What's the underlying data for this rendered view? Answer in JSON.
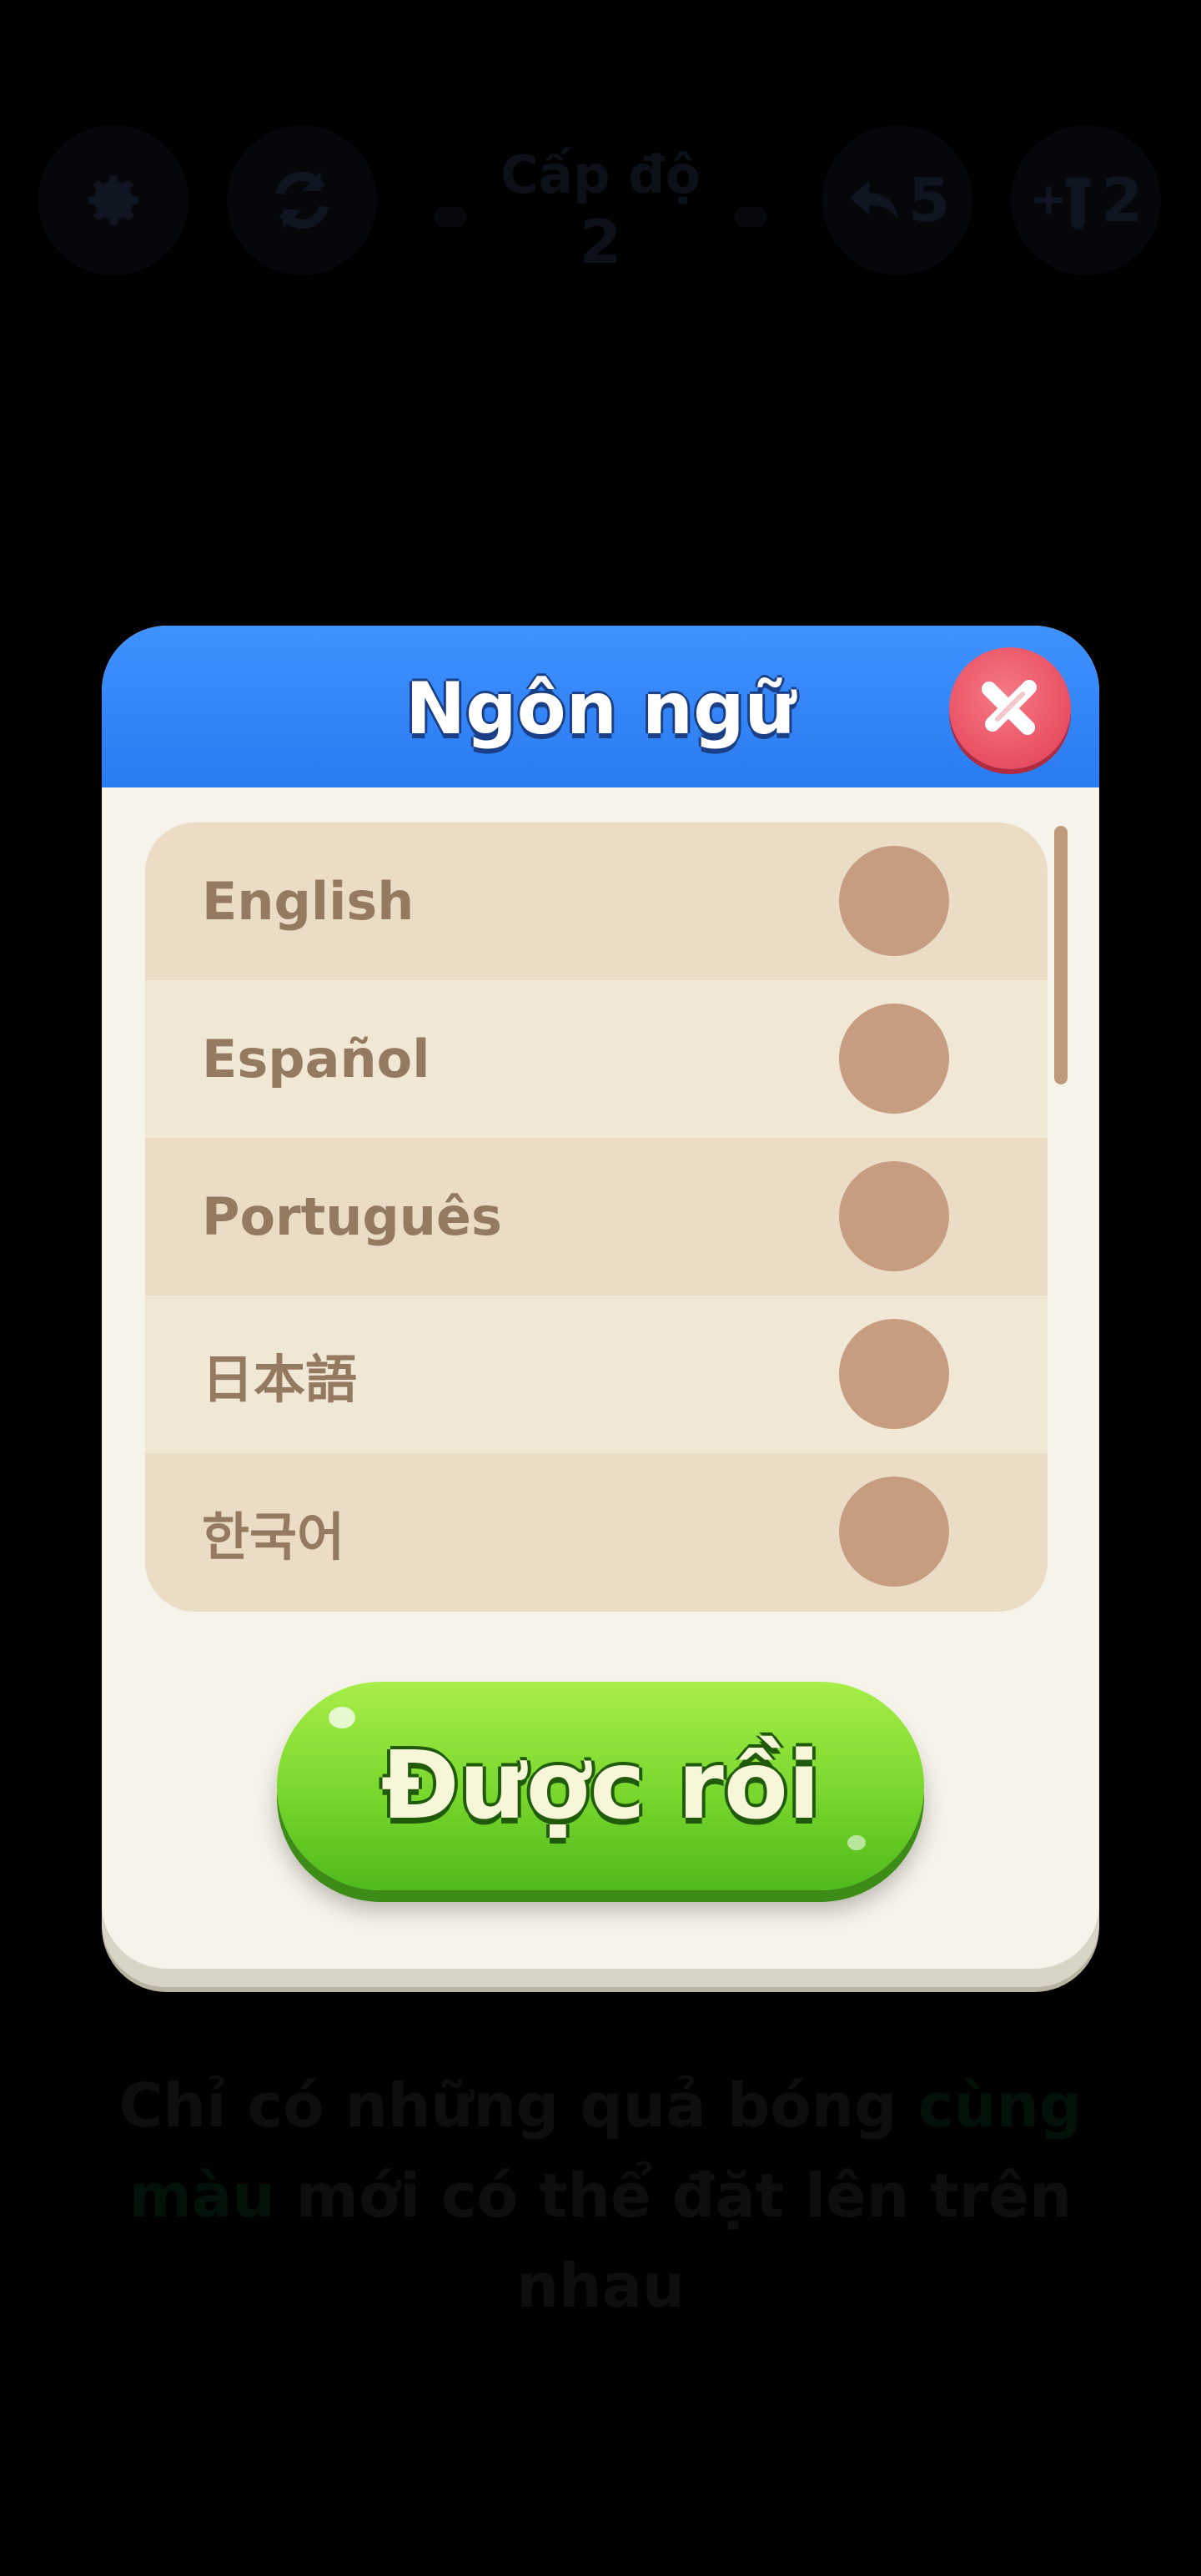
{
  "hud": {
    "settings_icon": "gear-icon",
    "restart_icon": "restart-icon",
    "level_title": "Cấp độ",
    "level_number": "2",
    "undo_icon": "undo-icon",
    "undo_count": "5",
    "add_tube_icon": "add-tube-icon",
    "add_tube_count": "2"
  },
  "hint": {
    "part1": "Chỉ có những quả bóng ",
    "highlight": "cùng màu",
    "part2": " mới có thể đặt lên trên nhau"
  },
  "dialog": {
    "title": "Ngôn ngữ",
    "close_icon": "close-icon",
    "languages": [
      {
        "label": "English",
        "selected": false
      },
      {
        "label": "Español",
        "selected": false
      },
      {
        "label": "Português",
        "selected": false
      },
      {
        "label": "日本語",
        "selected": false
      },
      {
        "label": "한국어",
        "selected": false
      }
    ],
    "ok_label": "Được rồi"
  },
  "colors": {
    "header_blue": "#2a7bf1",
    "close_red": "#e23c53",
    "ok_green": "#78d62c",
    "row_text": "#957a62",
    "radio": "#c79d82"
  }
}
